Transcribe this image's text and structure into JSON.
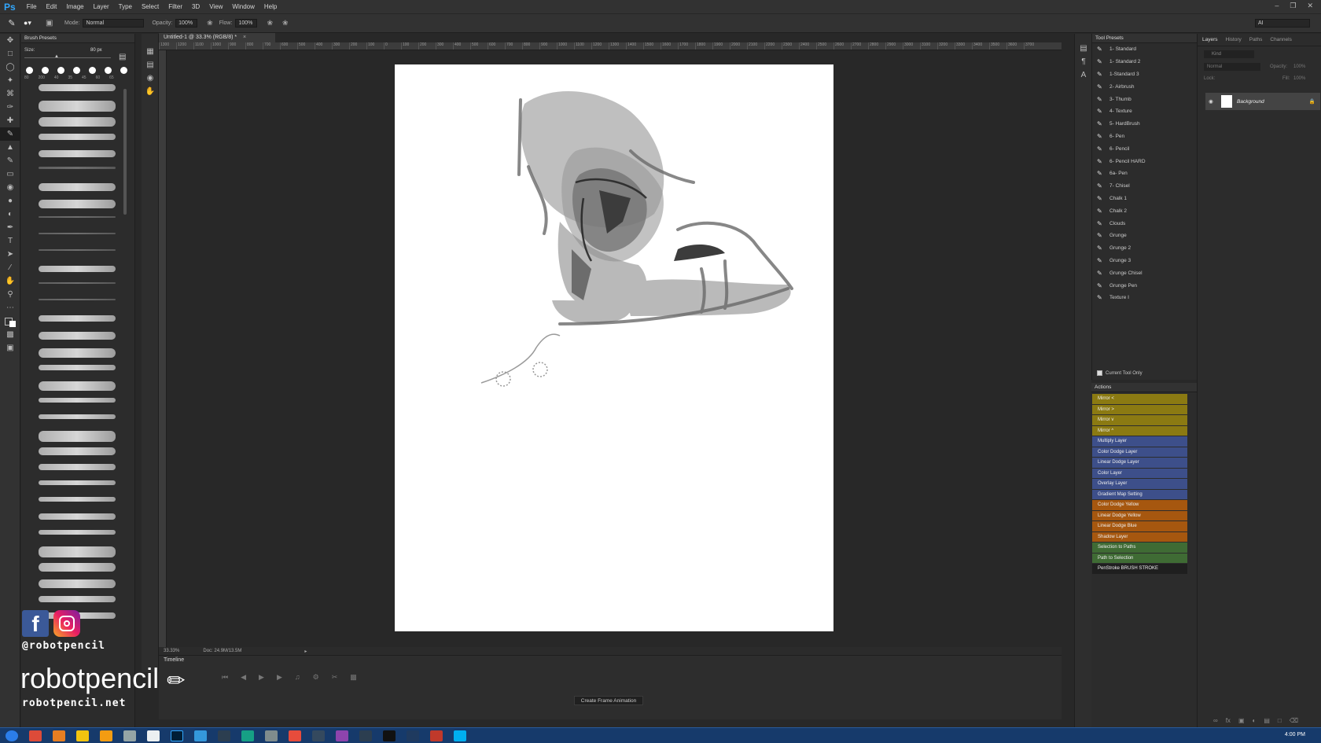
{
  "app": {
    "logo": "Ps"
  },
  "menu": [
    "File",
    "Edit",
    "Image",
    "Layer",
    "Type",
    "Select",
    "Filter",
    "3D",
    "View",
    "Window",
    "Help"
  ],
  "options": {
    "mode_label": "Mode:",
    "mode_value": "Normal",
    "opacity_label": "Opacity:",
    "opacity_value": "100%",
    "flow_label": "Flow:",
    "flow_value": "100%",
    "workspace_value": "AI"
  },
  "brush_presets": {
    "title": "Brush Presets",
    "size_label": "Size:",
    "size_value": "80 px",
    "tip_sizes": [
      "80",
      "200",
      "40",
      "35",
      "45",
      "60",
      "65"
    ]
  },
  "document": {
    "tab": "Untitled-1 @ 33.3% (RGB/8) *",
    "ruler_ticks": [
      "1300",
      "1200",
      "1100",
      "1000",
      "900",
      "800",
      "700",
      "600",
      "500",
      "400",
      "300",
      "200",
      "100",
      "0",
      "100",
      "200",
      "300",
      "400",
      "500",
      "600",
      "700",
      "800",
      "900",
      "1000",
      "1100",
      "1200",
      "1300",
      "1400",
      "1500",
      "1600",
      "1700",
      "1800",
      "1900",
      "2000",
      "2100",
      "2200",
      "2300",
      "2400",
      "2500",
      "2600",
      "2700",
      "2800",
      "2900",
      "3000",
      "3100",
      "3200",
      "3300",
      "3400",
      "3500",
      "3600",
      "3700"
    ],
    "zoom": "33.33%",
    "doc_size": "Doc: 24.9M/13.5M"
  },
  "timeline": {
    "title": "Timeline",
    "button": "Create Frame Animation"
  },
  "tool_presets": {
    "title": "Tool Presets",
    "items": [
      "1- Standard",
      "1- Standard 2",
      "1-Standard 3",
      "2- Airbrush",
      "3- Thumb",
      "4- Texture",
      "5- HardBrush",
      "6- Pen",
      "6- Pencil",
      "6- Pencil HARD",
      "6a- Pen",
      "7- Chisel",
      "Chalk 1",
      "Chalk 2",
      "Clouds",
      "Grunge",
      "Grunge 2",
      "Grunge 3",
      "Grunge Chisel",
      "Grunge Pen",
      "Texture I"
    ],
    "current_tool_only": "Current Tool Only"
  },
  "actions": {
    "title": "Actions",
    "items": [
      {
        "label": "Mirror <",
        "color": "#8b7a12"
      },
      {
        "label": "Mirror >",
        "color": "#8b7a12"
      },
      {
        "label": "Mirror v",
        "color": "#8b7a12"
      },
      {
        "label": "Mirror ^",
        "color": "#8b7a12"
      },
      {
        "label": "Multiply Layer",
        "color": "#3d4f8a"
      },
      {
        "label": "Color Dodge Layer",
        "color": "#3d4f8a"
      },
      {
        "label": "Linear Dodge Layer",
        "color": "#3d4f8a"
      },
      {
        "label": "Color Layer",
        "color": "#3d4f8a"
      },
      {
        "label": "Overlay Layer",
        "color": "#3d4f8a"
      },
      {
        "label": "Gradient Map Setting",
        "color": "#3d4f8a"
      },
      {
        "label": "Color Dodge Yellow",
        "color": "#a6570f"
      },
      {
        "label": "Linear Dodge Yellow",
        "color": "#a6570f"
      },
      {
        "label": "Linear Dodge Blue",
        "color": "#a6570f"
      },
      {
        "label": "Shadow Layer",
        "color": "#a6570f"
      },
      {
        "label": "Selection to Paths",
        "color": "#3f6b34"
      },
      {
        "label": "Path to Selection",
        "color": "#3f6b34"
      },
      {
        "label": "PenStroke BRUSH STROKE",
        "color": "#1f1f1f"
      }
    ]
  },
  "layers": {
    "tabs": [
      "Layers",
      "History",
      "Paths",
      "Channels"
    ],
    "kind": "Kind",
    "blend": "Normal",
    "opacity_label": "Opacity:",
    "opacity_value": "100%",
    "lock_label": "Lock:",
    "fill_label": "Fill:",
    "fill_value": "100%",
    "background_layer": "Background"
  },
  "watermark": {
    "handle": "@robotpencil",
    "brand": "robotpencil",
    "site": "robotpencil.net"
  },
  "taskbar": {
    "time": "4:00 PM"
  }
}
